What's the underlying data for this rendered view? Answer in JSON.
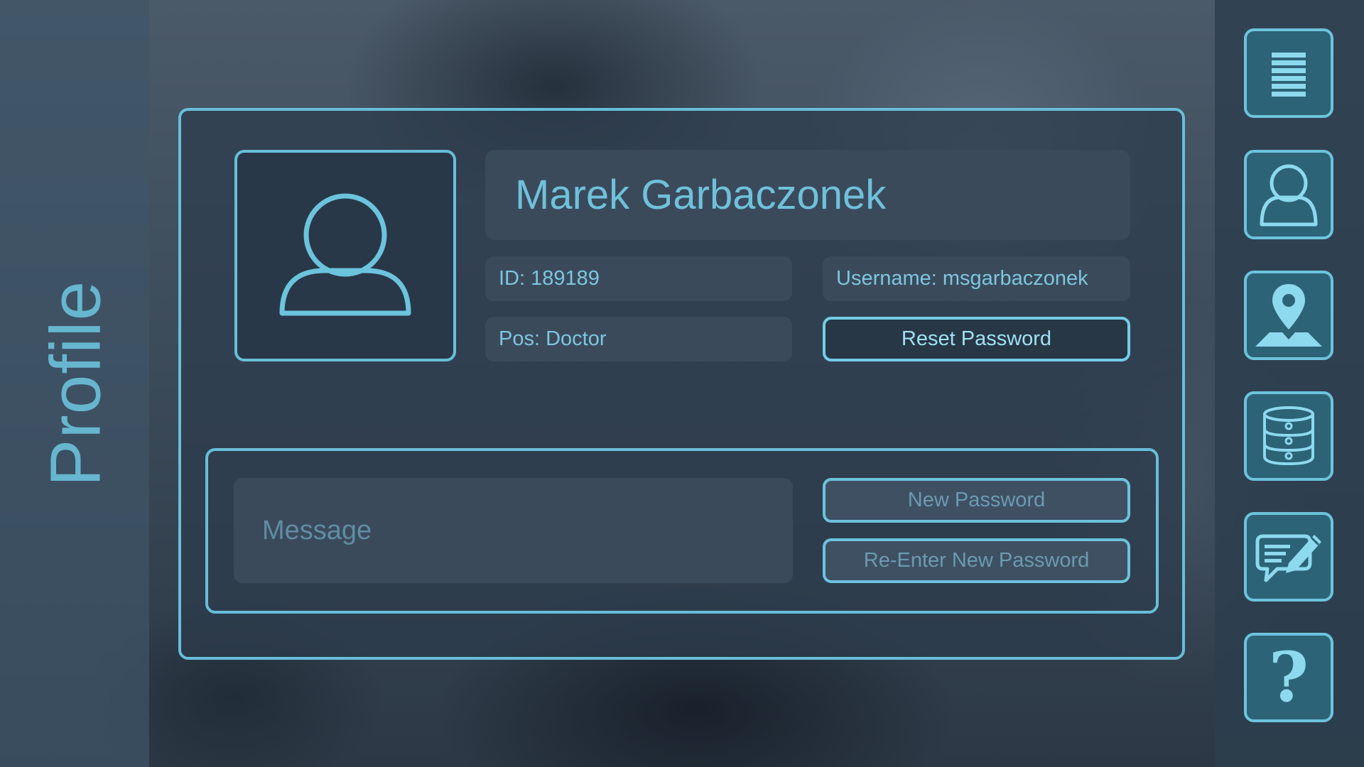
{
  "sidebar": {
    "title": "Profile"
  },
  "nav": {
    "items": [
      {
        "name": "list",
        "icon": "list-icon"
      },
      {
        "name": "profile",
        "icon": "user-icon"
      },
      {
        "name": "location",
        "icon": "map-pin-icon"
      },
      {
        "name": "database",
        "icon": "database-icon"
      },
      {
        "name": "message",
        "icon": "chat-edit-icon"
      },
      {
        "name": "help",
        "icon": "help-icon",
        "glyph": "?"
      }
    ]
  },
  "profile": {
    "name": "Marek Garbaczonek",
    "id_label": "ID: 189189",
    "username_label": "Username: msgarbaczonek",
    "position_label": "Pos: Doctor",
    "reset_password_label": "Reset Password"
  },
  "password_form": {
    "message_placeholder": "Message",
    "new_password_placeholder": "New Password",
    "reenter_password_placeholder": "Re-Enter New Password"
  },
  "colors": {
    "accent": "#68bed8",
    "text": "#6fc1da",
    "nav_button_fill": "#2d6377"
  }
}
